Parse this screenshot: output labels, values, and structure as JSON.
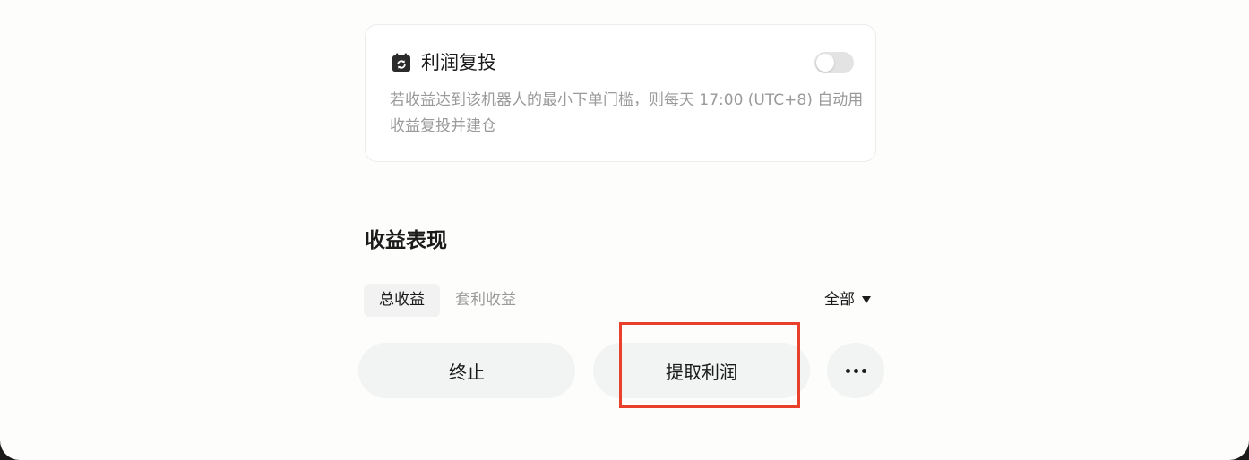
{
  "reinvest_card": {
    "icon": "calendar-refresh-icon",
    "title": "利润复投",
    "toggle_on": false,
    "description": "若收益达到该机器人的最小下单门槛，则每天 17:00 (UTC+8) 自动用收益复投并建仓"
  },
  "performance": {
    "title": "收益表现",
    "tabs": [
      {
        "label": "总收益",
        "active": true
      },
      {
        "label": "套利收益",
        "active": false
      }
    ],
    "filter_label": "全部"
  },
  "actions": {
    "stop_label": "终止",
    "withdraw_label": "提取利润",
    "more_icon": "more-dots-icon"
  },
  "colors": {
    "highlight": "#e8402a",
    "button_bg": "#f2f3f3",
    "toggle_off": "#e3e3e3"
  }
}
